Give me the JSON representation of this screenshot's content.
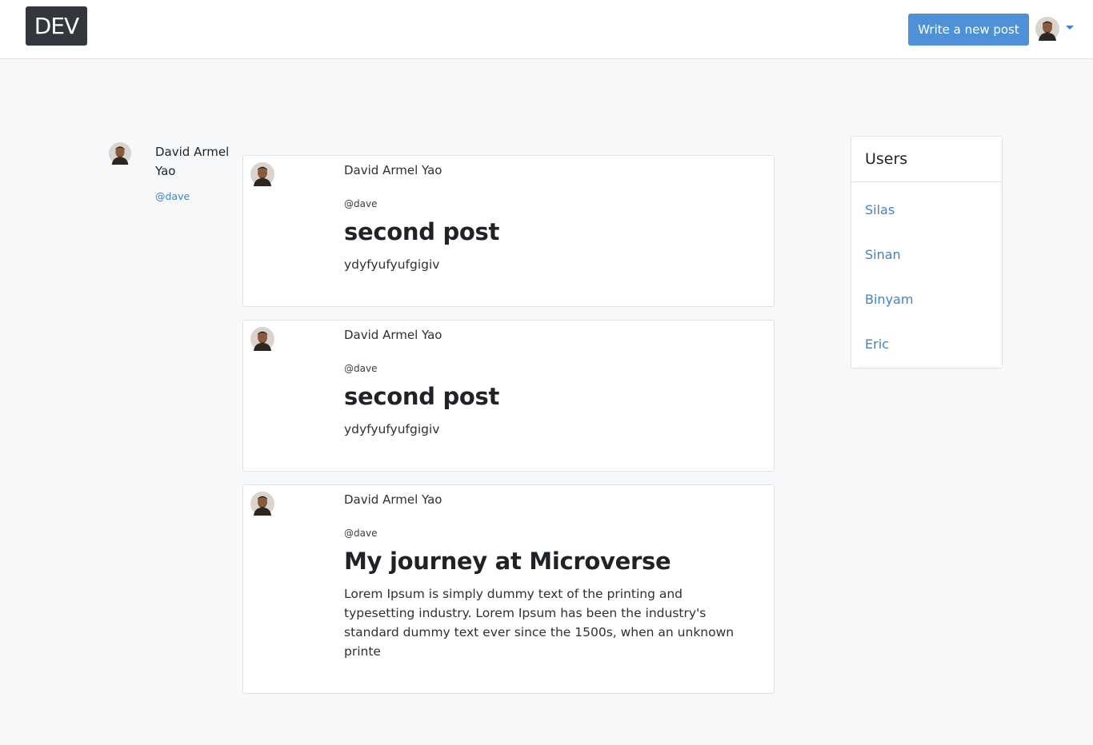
{
  "header": {
    "logo_text": "DEV",
    "write_button_label": "Write a new post",
    "avatar_icon": "user-avatar-photo",
    "menu_icon": "chevron-down-icon"
  },
  "profile": {
    "name": "David Armel Yao",
    "handle": "@dave"
  },
  "posts": [
    {
      "author": "David Armel Yao",
      "handle": "@dave",
      "title": "second post",
      "body": "ydyfyufyufgigiv"
    },
    {
      "author": "David Armel Yao",
      "handle": "@dave",
      "title": "second post",
      "body": "ydyfyufyufgigiv"
    },
    {
      "author": "David Armel Yao",
      "handle": "@dave",
      "title": "My journey at Microverse",
      "body": "Lorem Ipsum is simply dummy text of the printing and typesetting industry. Lorem Ipsum has been the industry's standard dummy text ever since the 1500s, when an unknown printe"
    }
  ],
  "users_panel": {
    "title": "Users",
    "users": [
      "Silas",
      "Sinan",
      "Binyam",
      "Eric"
    ]
  },
  "colors": {
    "accent": "#4f91d6",
    "link": "#3f82cf",
    "logo_bg": "#33363b",
    "page_bg": "#f7f8fa"
  }
}
